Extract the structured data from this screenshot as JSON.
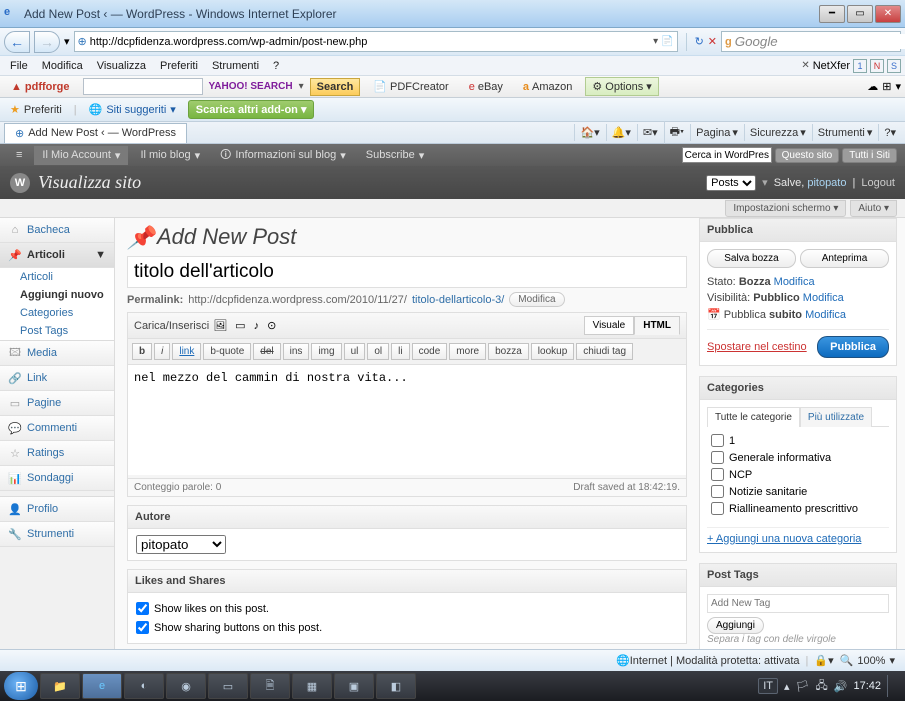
{
  "window": {
    "title": "Add New Post ‹  — WordPress - Windows Internet Explorer",
    "url": "http://dcpfidenza.wordpress.com/wp-admin/post-new.php",
    "search_engine_label": "Google"
  },
  "ie_menu": {
    "file": "File",
    "edit": "Modifica",
    "view": "Visualizza",
    "pref": "Preferiti",
    "tools": "Strumenti",
    "help": "?",
    "netxfer": "NetXfer"
  },
  "toolbar2": {
    "pdfforge": "pdfforge",
    "yahoo": "YAHOO! SEARCH",
    "search": "Search",
    "pdfcreator": "PDFCreator",
    "ebay": "eBay",
    "amazon": "Amazon",
    "options": "Options"
  },
  "favbar": {
    "favorites": "Preferiti",
    "suggested": "Siti suggeriti",
    "download": "Scarica altri add-on"
  },
  "ie_tab": "Add New Post ‹  — WordPress",
  "cmdbar": {
    "page": "Pagina",
    "security": "Sicurezza",
    "tools": "Strumenti"
  },
  "wpbar": {
    "account": "Il Mio Account",
    "blog": "Il mio blog",
    "info": "Informazioni sul blog",
    "subscribe": "Subscribe",
    "search_ph": "Cerca in WordPress.com",
    "thissite": "Questo sito",
    "allsites": "Tutti i Siti"
  },
  "wphead": {
    "site": "Visualizza sito",
    "posts_label": "Posts",
    "greet": "Salve,",
    "user": "pitopato",
    "logout": "Logout"
  },
  "screenopts": {
    "settings": "Impostazioni schermo",
    "help": "Aiuto"
  },
  "sidebar": {
    "dashboard": "Bacheca",
    "articles": "Articoli",
    "articles_sub": {
      "all": "Articoli",
      "add": "Aggiungi nuovo",
      "cats": "Categories",
      "tags": "Post Tags"
    },
    "media": "Media",
    "link": "Link",
    "pages": "Pagine",
    "comments": "Commenti",
    "ratings": "Ratings",
    "sondaggi": "Sondaggi",
    "profile": "Profilo",
    "tools": "Strumenti"
  },
  "page": {
    "heading": "Add New Post",
    "title_value": "titolo dell'articolo",
    "permalink_label": "Permalink:",
    "permalink_base": "http://dcpfidenza.wordpress.com/2010/11/27/",
    "permalink_slug": "titolo-dellarticolo-3/",
    "edit": "Modifica",
    "upload_label": "Carica/Inserisci",
    "tab_visual": "Visuale",
    "tab_html": "HTML",
    "qtags": {
      "b": "b",
      "i": "i",
      "link": "link",
      "bquote": "b-quote",
      "del": "del",
      "ins": "ins",
      "img": "img",
      "ul": "ul",
      "ol": "ol",
      "li": "li",
      "code": "code",
      "more": "more",
      "bozza": "bozza",
      "lookup": "lookup",
      "close": "chiudi tag"
    },
    "content": "nel mezzo del cammin di nostra vita...",
    "wordcount_label": "Conteggio parole:",
    "wordcount": "0",
    "draft_saved": "Draft saved at 18:42:19."
  },
  "author": {
    "heading": "Autore",
    "value": "pitopato"
  },
  "likes": {
    "heading": "Likes and Shares",
    "show_likes": "Show likes on this post.",
    "show_sharing": "Show sharing buttons on this post."
  },
  "publish": {
    "heading": "Pubblica",
    "save": "Salva bozza",
    "preview": "Anteprima",
    "status_lbl": "Stato:",
    "status_val": "Bozza",
    "edit": "Modifica",
    "vis_lbl": "Visibilità:",
    "vis_val": "Pubblico",
    "pub_lbl": "Pubblica",
    "pub_val": "subito",
    "trash": "Spostare nel cestino",
    "publish": "Pubblica"
  },
  "categories": {
    "heading": "Categories",
    "all": "Tutte le categorie",
    "most": "Più utilizzate",
    "items": [
      "1",
      "Generale informativa",
      "NCP",
      "Notizie sanitarie",
      "Riallineamento prescrittivo"
    ],
    "add": "+ Aggiungi una nuova categoria"
  },
  "tags": {
    "heading": "Post Tags",
    "placeholder": "Add New Tag",
    "add": "Aggiungi",
    "hint": "Separa i tag con delle virgole"
  },
  "statusbar": {
    "internet": "Internet | Modalità protetta: attivata",
    "zoom": "100%"
  },
  "taskbar": {
    "time": "17:42",
    "lang": "IT"
  }
}
